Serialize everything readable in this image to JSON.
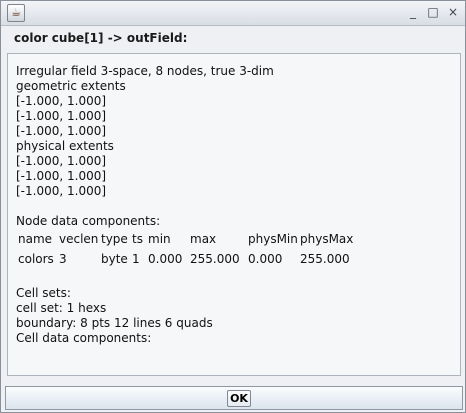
{
  "window": {
    "title": "",
    "dialog_heading": "color cube[1] -> outField:"
  },
  "content": {
    "lines": [
      "Irregular field 3-space, 8 nodes, true 3-dim",
      "geometric extents",
      "[-1.000, 1.000]",
      "[-1.000, 1.000]",
      "[-1.000, 1.000]",
      "physical extents",
      "[-1.000, 1.000]",
      "[-1.000, 1.000]",
      "[-1.000, 1.000]",
      "",
      "Node data components:"
    ],
    "table": {
      "headers": [
        "name",
        "veclen",
        "type",
        "ts",
        "min",
        "max",
        "physMin",
        "physMax"
      ],
      "rows": [
        [
          "colors",
          "3",
          "byte",
          "1",
          "0.000",
          "255.000",
          "0.000",
          "255.000"
        ]
      ]
    },
    "cell_lines": [
      "Cell sets:",
      "cell set: 1 hexs",
      "boundary: 8 pts 12 lines 6 quads",
      "Cell data components:"
    ]
  },
  "buttons": {
    "ok": "OK"
  },
  "icons": {
    "app": "java-icon",
    "minimize": "minimize-icon",
    "maximize": "maximize-icon",
    "close": "close-icon"
  }
}
